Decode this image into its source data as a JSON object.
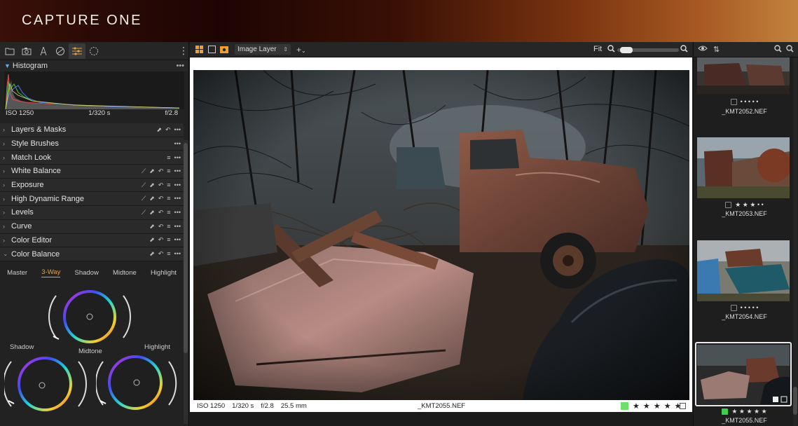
{
  "app": {
    "brand": "CAPTURE ONE"
  },
  "left": {
    "tool_tabs": [
      "folder-icon",
      "camera-icon",
      "lens-icon",
      "color-icon",
      "adjust-icon",
      "details-icon"
    ],
    "histogram": {
      "title": "Histogram",
      "iso": "ISO 1250",
      "shutter": "1/320 s",
      "aperture": "f/2.8"
    },
    "tools": [
      {
        "label": "Layers & Masks",
        "icons": [
          "copy",
          "reset",
          "more"
        ]
      },
      {
        "label": "Style Brushes",
        "icons": [
          "more"
        ]
      },
      {
        "label": "Match Look",
        "icons": [
          "presets",
          "more"
        ]
      },
      {
        "label": "White Balance",
        "icons": [
          "picker",
          "copy",
          "reset",
          "presets",
          "more"
        ]
      },
      {
        "label": "Exposure",
        "icons": [
          "picker",
          "copy",
          "reset",
          "presets",
          "more"
        ]
      },
      {
        "label": "High Dynamic Range",
        "icons": [
          "picker",
          "copy",
          "reset",
          "presets",
          "more"
        ]
      },
      {
        "label": "Levels",
        "icons": [
          "picker",
          "copy",
          "reset",
          "presets",
          "more"
        ]
      },
      {
        "label": "Curve",
        "icons": [
          "copy",
          "reset",
          "presets",
          "more"
        ]
      },
      {
        "label": "Color Editor",
        "icons": [
          "copy",
          "reset",
          "presets",
          "more"
        ]
      },
      {
        "label": "Color Balance",
        "icons": [
          "copy",
          "reset",
          "presets",
          "more"
        ]
      }
    ],
    "color_balance": {
      "tabs": [
        "Master",
        "3-Way",
        "Shadow",
        "Midtone",
        "Highlight"
      ],
      "active_tab": "3-Way",
      "wheels": {
        "shadow": "Shadow",
        "midtone": "Midtone",
        "highlight": "Highlight"
      }
    }
  },
  "viewer": {
    "layer_select": "Image Layer",
    "fit_label": "Fit",
    "zoom_level": 0.05,
    "status": {
      "iso": "ISO 1250",
      "shutter": "1/320 s",
      "aperture": "f/2.8",
      "focal": "25.5 mm",
      "filename": "_KMT2055.NEF",
      "stars": "★ ★ ★ ★ ★",
      "color_tag": "#6ee06a"
    }
  },
  "browser": {
    "items": [
      {
        "filename": "_KMT2052.NEF",
        "rating": "• • • • •",
        "selected": false
      },
      {
        "filename": "_KMT2053.NEF",
        "rating": "★ ★ ★ • •",
        "selected": false
      },
      {
        "filename": "_KMT2054.NEF",
        "rating": "• • • • •",
        "selected": false
      },
      {
        "filename": "_KMT2055.NEF",
        "rating": "★ ★ ★ ★ ★",
        "selected": true
      }
    ]
  },
  "colors": {
    "accent": "#e8a040",
    "selection": "#3fcf4f"
  }
}
